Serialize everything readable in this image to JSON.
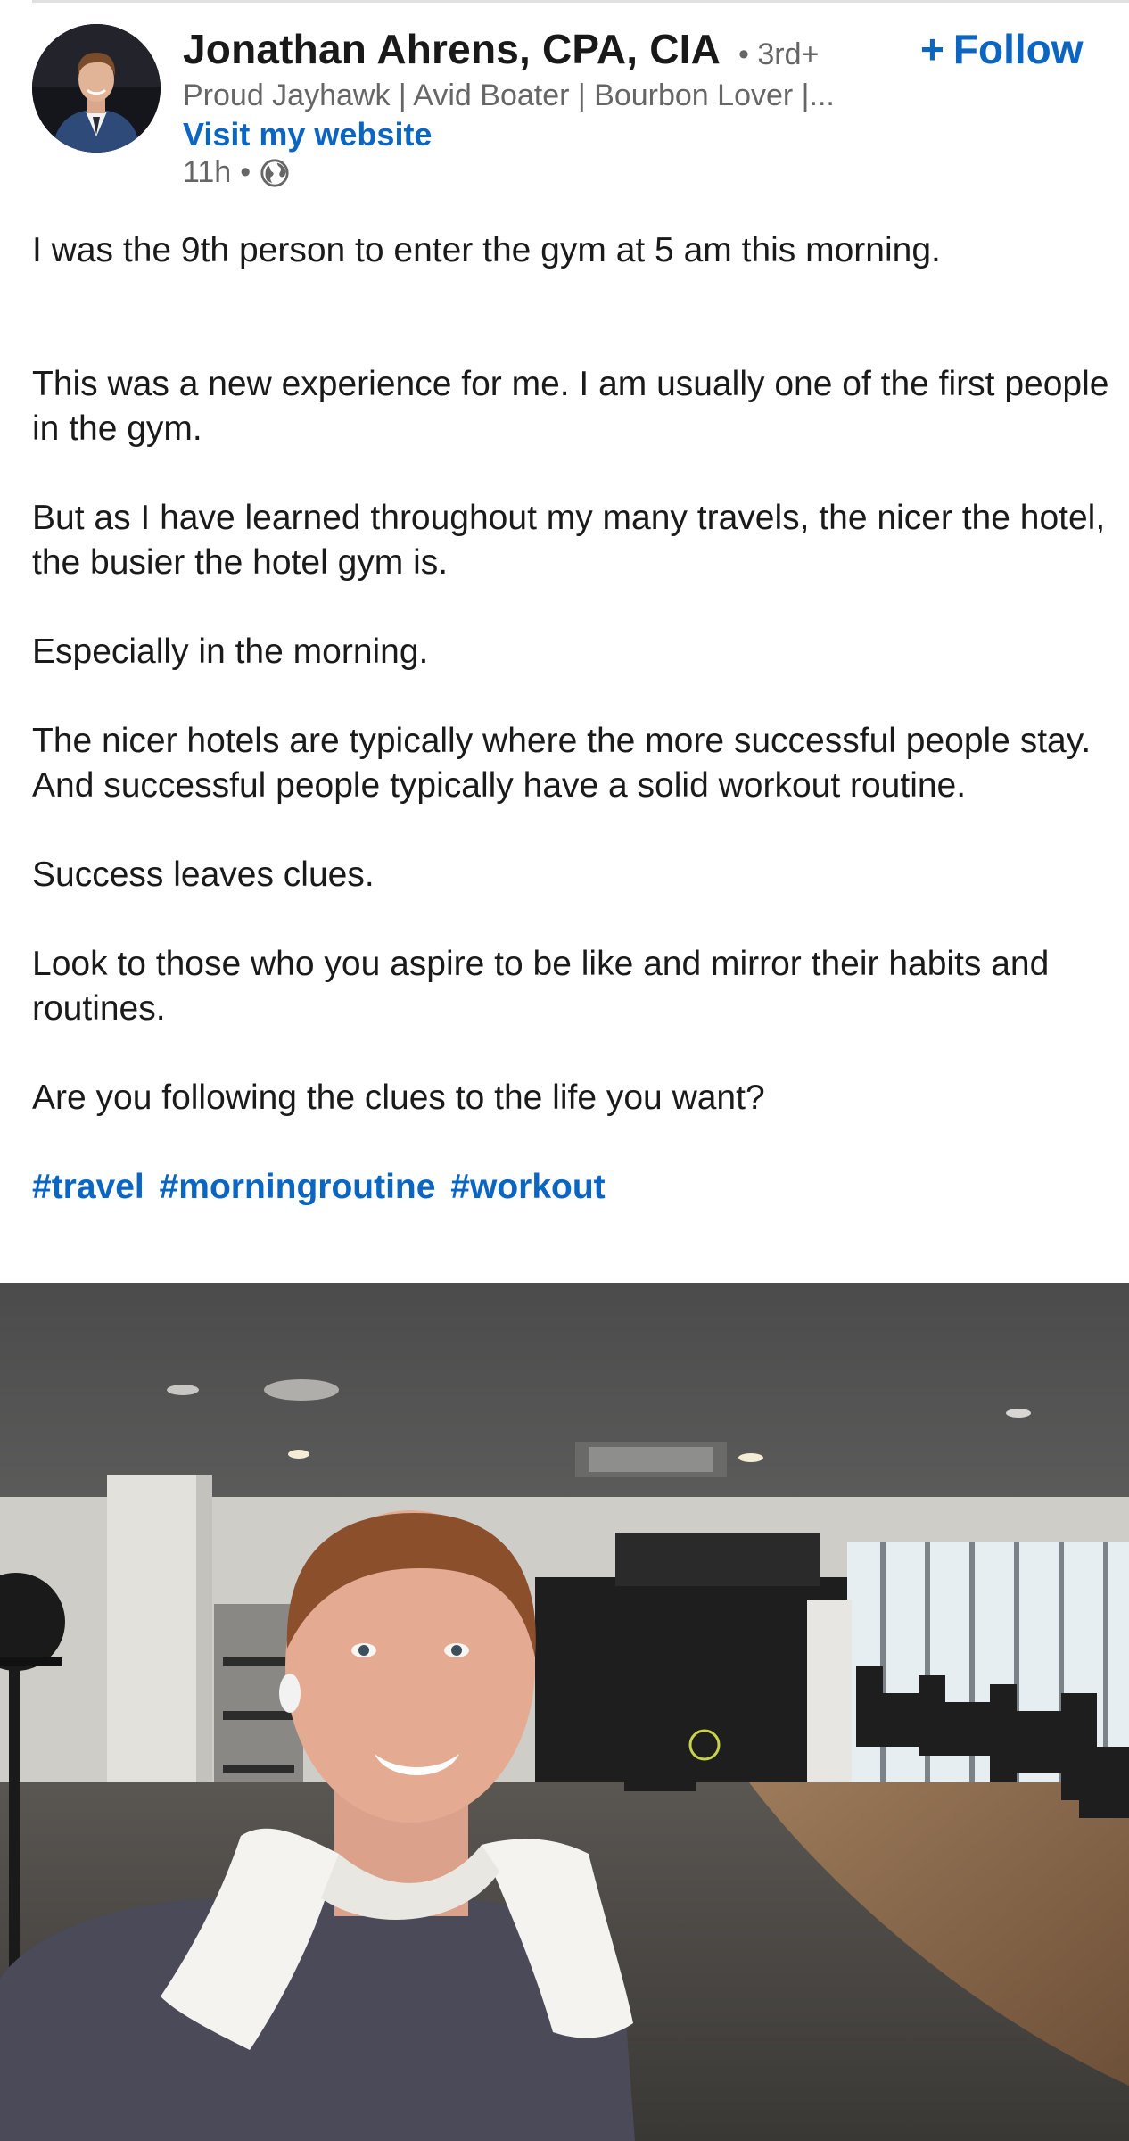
{
  "post": {
    "author": {
      "name": "Jonathan Ahrens, CPA, CIA",
      "degree": "• 3rd+",
      "headline": "Proud Jayhawk | Avid Boater | Bourbon Lover |...",
      "website_label": "Visit my website",
      "time": "11h",
      "visibility_icon": "globe-icon"
    },
    "follow_label": "Follow",
    "follow_icon": "plus-icon",
    "paragraphs": [
      "I was the 9th person to enter the gym at 5 am this morning.",
      "This was a new experience for me. I am usually one of the first people in the gym.",
      "But as I have learned throughout my many travels, the nicer the hotel, the busier the hotel gym is.",
      "Especially in the morning.",
      "The nicer hotels are typically where the more successful people stay. And successful people typically have a solid workout routine.",
      "Success leaves clues.",
      "Look to those who you aspire to be like and mirror their habits and routines.",
      "Are you following the clues to the life you want?"
    ],
    "hashtags": [
      "#travel",
      "#morningroutine",
      "#workout"
    ]
  },
  "colors": {
    "link_blue": "#0a66c2",
    "text": "#1a1a1a",
    "secondary_text": "#666666"
  }
}
